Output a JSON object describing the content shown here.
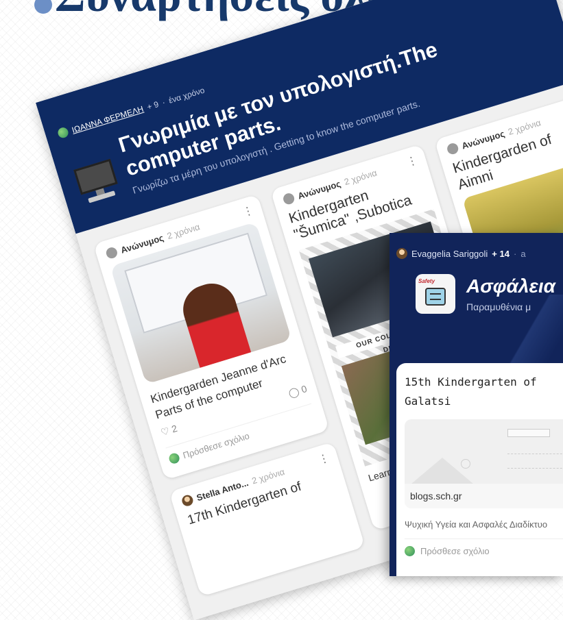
{
  "slide": {
    "title": "Σύναρτησεις όλων"
  },
  "board1": {
    "author": "ΙΩΑΝΝΑ ΦΕΡΜΕΛΗ",
    "plus": "+ 9",
    "time": "ένα χρόνο",
    "title": "Γνωριμία με τον υπολογιστή.The computer parts.",
    "subtitle": "Γνωρίζω τα μέρη του υπολογιστή . Getting to know the computer parts.",
    "actions": [
      "heart-icon",
      "repost-icon",
      "share-icon",
      "open-icon"
    ],
    "cards": [
      {
        "author": "Ανώνυμος",
        "time": "2 χρόνια",
        "title": "Kindergarden Jeanne d'Arc",
        "body": "Parts of the computer",
        "likes": "2",
        "comments": "0",
        "add_comment": "Πρόσθεσε σχόλιο"
      },
      {
        "author": "Ανώνυμος",
        "time": "2 χρόνια",
        "title": "Kindergarten \"Šumica\" ,Subotica",
        "banner": "OUR COLLABORATIVE DRAWING",
        "footer": "Learning & playing"
      },
      {
        "author": "Ανώνυμος",
        "time": "2 χρόνια",
        "title": "Kindergarden of Aimni"
      },
      {
        "author": "Stella Anto...",
        "time": "2 χρόνια",
        "title": "17th Kindergarten of"
      }
    ]
  },
  "board2": {
    "author": "Evaggelia Sariggoli",
    "plus": "+ 14",
    "time": "a",
    "logo_label": "Safety",
    "title": "Ασφάλεια",
    "subtitle": "Παραμυθένια μ",
    "card": {
      "title": "15th Kindergarten of Galatsi",
      "domain": "blogs.sch.gr",
      "description": "Ψυχική Υγεία και Ασφαλές Διαδίκτυο",
      "add_comment": "Πρόσθεσε σχόλιο"
    }
  }
}
